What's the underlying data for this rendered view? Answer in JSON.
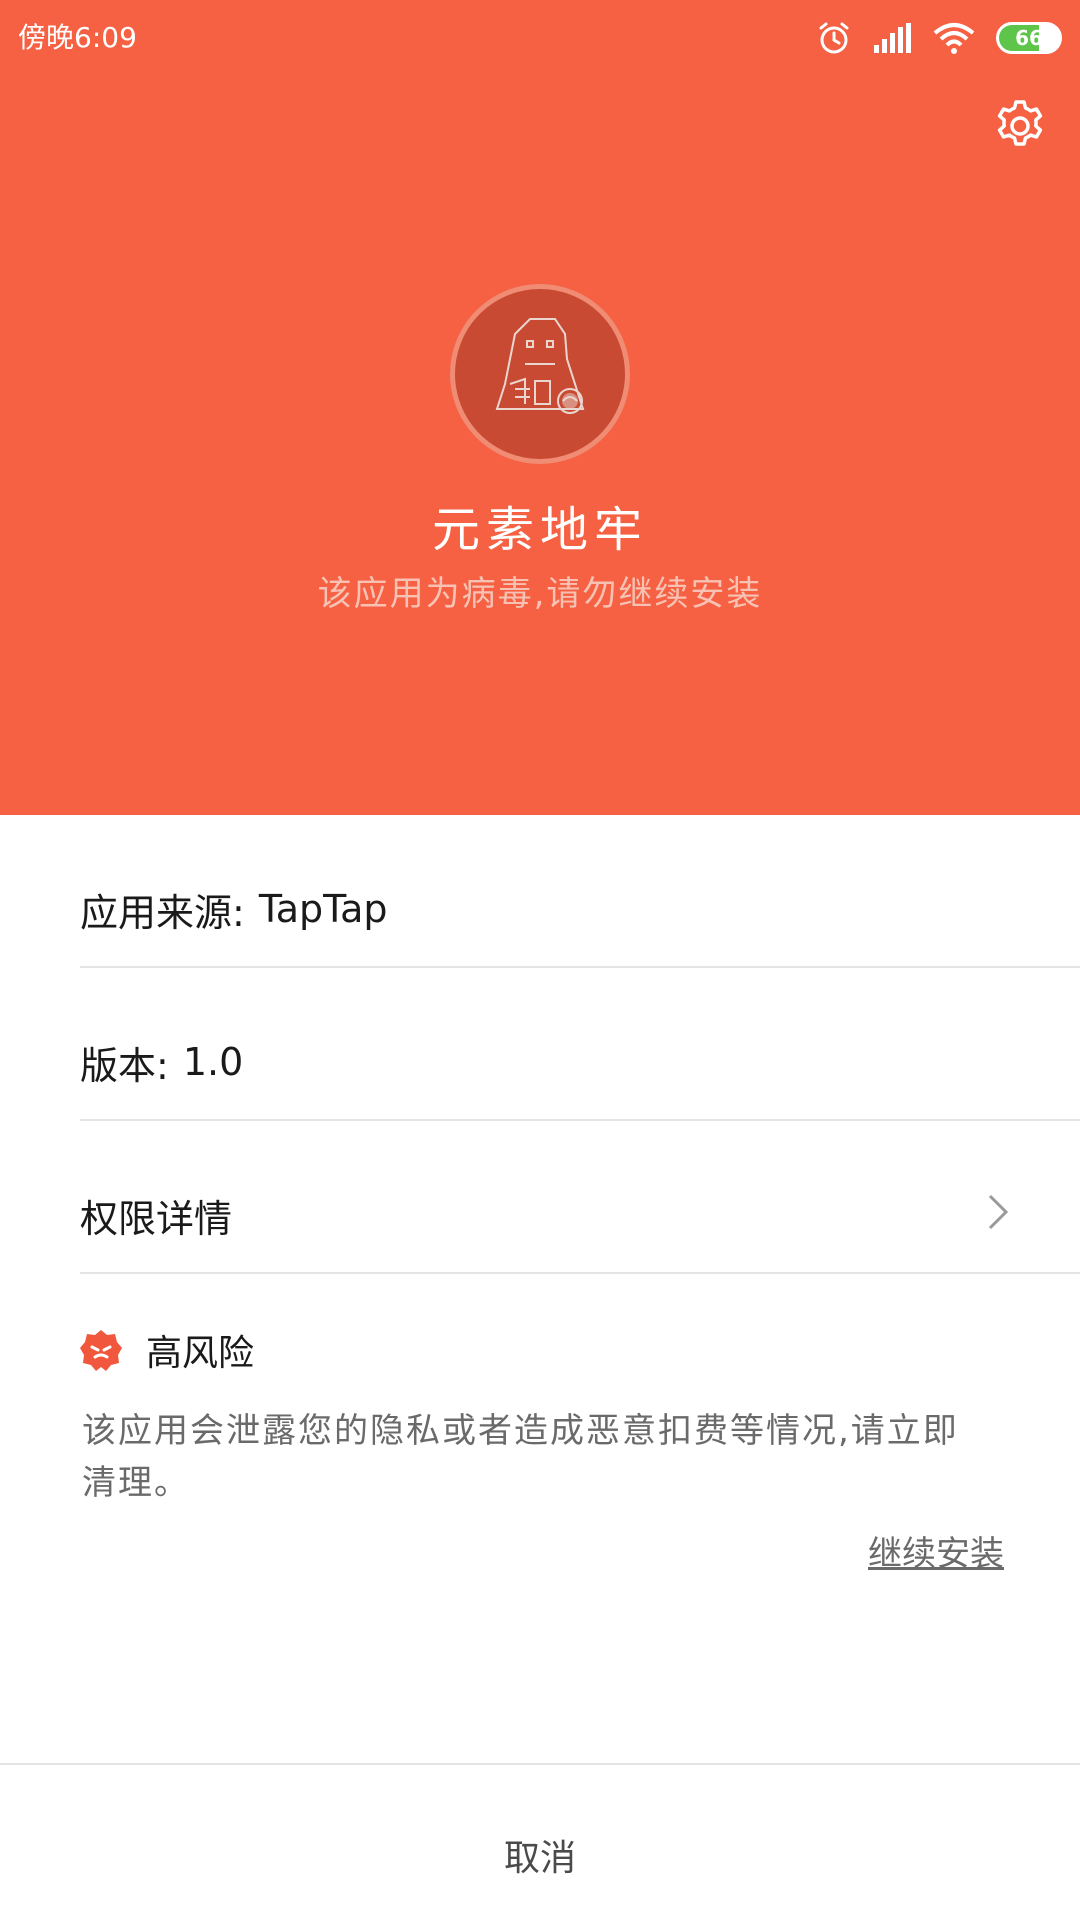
{
  "status_bar": {
    "time": "傍晚6:09",
    "battery_level": 66,
    "battery_label": "66",
    "icons": [
      "alarm-icon",
      "signal-icon",
      "wifi-icon",
      "battery-icon"
    ]
  },
  "header": {
    "settings_icon": "gear-icon",
    "app_icon": "dungeon-app-icon",
    "app_name": "元素地牢",
    "warning": "该应用为病毒,请勿继续安装",
    "background_color": "#f56142"
  },
  "info": {
    "source_label": "应用来源:",
    "source_value": "TapTap",
    "version_label": "版本:",
    "version_value": "1.0",
    "permissions_label": "权限详情"
  },
  "risk": {
    "title": "高风险",
    "description": "该应用会泄露您的隐私或者造成恶意扣费等情况,请立即清理。",
    "continue_link": "继续安装",
    "badge_color": "#f0573c"
  },
  "footer": {
    "cancel_label": "取消"
  }
}
